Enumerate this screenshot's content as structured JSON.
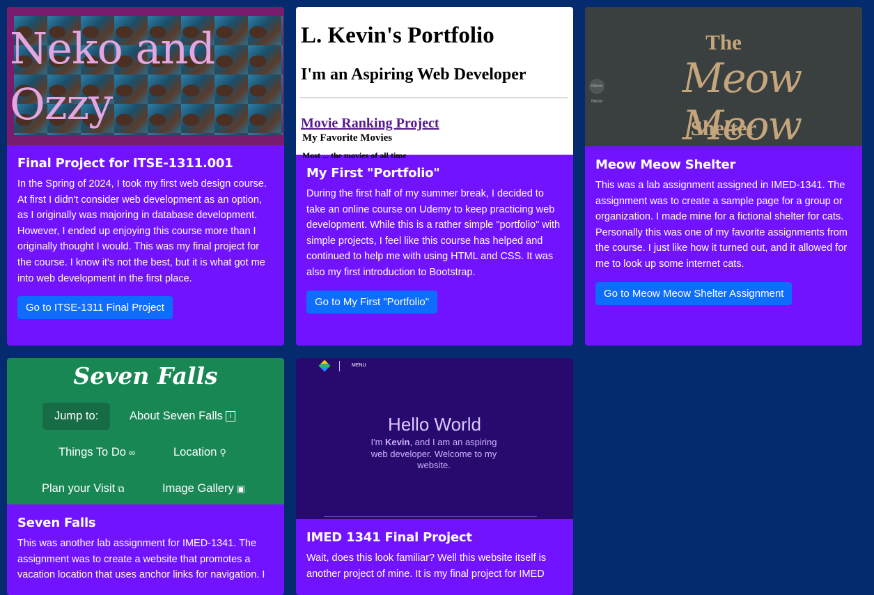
{
  "cards": [
    {
      "image": {
        "title": "Neko and Ozzy"
      },
      "title": "Final Project for ITSE-1311.001",
      "text": "In the Spring of 2024, I took my first web design course. At first I didn't consider web development as an option, as I originally was majoring in database development. However, I ended up enjoying this course more than I originally thought I would. This was my final project for the course. I know it's not the best, but it is what got me into web development in the first place.",
      "button": "Go to ITSE-1311 Final Project"
    },
    {
      "image": {
        "heading": "L. Kevin's Portfolio",
        "subheading": "I'm an Aspiring Web Developer",
        "link": "Movie Ranking Project",
        "sub": "My Favorite Movies",
        "cut": "Most ... the movies of all time"
      },
      "title": "My First \"Portfolio\"",
      "text": "During the first half of my summer break, I decided to take an online course on Udemy to keep practicing web development. While this is a rather simple \"portfolio\" with simple projects, I feel like this course has helped and continued to help me with using HTML and CSS. It was also my first introduction to Bootstrap.",
      "button": "Go to My First \"Portfolio\""
    },
    {
      "image": {
        "the": "The",
        "meow": "Meow Meow",
        "shelter": "Shelter",
        "badge": "Meow Meow"
      },
      "title": "Meow Meow Shelter",
      "text": "This was a lab assignment assigned in IMED-1341. The assignment was to create a sample page for a group or organization. I made mine for a fictional shelter for cats. Personally this was one of my favorite assignments from the course. I just like how it turned out, and it allowed for me to look up some internet cats.",
      "button": "Go to Meow Meow Shelter Assignment"
    },
    {
      "image": {
        "logo": "Seven Falls",
        "jump": "Jump to:",
        "about": "About Seven Falls",
        "todo": "Things To Do",
        "location": "Location",
        "plan": "Plan your Visit",
        "gallery": "Image Gallery"
      },
      "title": "Seven Falls",
      "text": "This was another lab assignment for IMED-1341. The assignment was to create a website that promotes a vacation location that uses anchor links for navigation. I"
    },
    {
      "image": {
        "menu": "MENU",
        "hello": "Hello World",
        "lead_pre": "I'm ",
        "lead_name": "Kevin",
        "lead_post": ", and I am an aspiring web developer. Welcome to my website."
      },
      "title": "IMED 1341 Final Project",
      "text": "Wait, does this look familiar? Well this website itself is another project of mine. It is my final project for IMED"
    }
  ]
}
